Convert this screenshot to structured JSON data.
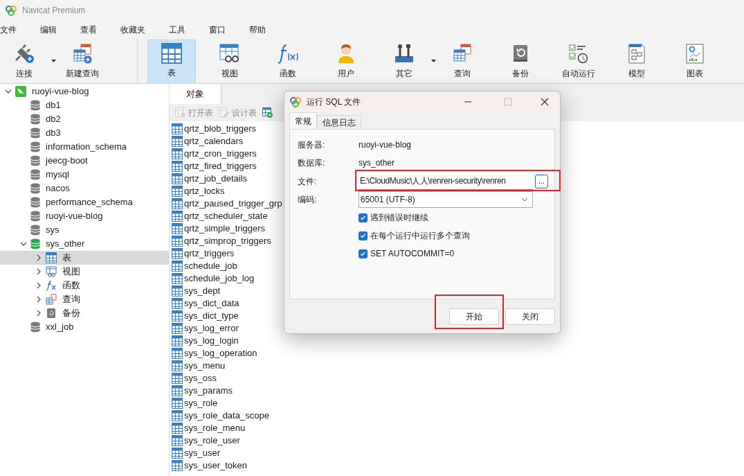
{
  "window": {
    "title": "Navicat Premium"
  },
  "menu": [
    "文件",
    "编辑",
    "查看",
    "收藏夹",
    "工具",
    "窗口",
    "帮助"
  ],
  "toolbar": [
    {
      "kind": "connect",
      "label": "连接",
      "selected": false,
      "dropdown": true
    },
    {
      "kind": "newquery",
      "label": "新建查询",
      "selected": false,
      "dropdown": false
    },
    {
      "kind": "table",
      "label": "表",
      "selected": true,
      "dropdown": false
    },
    {
      "kind": "view",
      "label": "视图",
      "selected": false,
      "dropdown": false
    },
    {
      "kind": "function",
      "label": "函数",
      "selected": false,
      "dropdown": false
    },
    {
      "kind": "user",
      "label": "用户",
      "selected": false,
      "dropdown": false
    },
    {
      "kind": "tools",
      "label": "其它",
      "selected": false,
      "dropdown": true
    },
    {
      "kind": "query",
      "label": "查询",
      "selected": false,
      "dropdown": false
    },
    {
      "kind": "backup",
      "label": "备份",
      "selected": false,
      "dropdown": false
    },
    {
      "kind": "schedule",
      "label": "自动运行",
      "selected": false,
      "dropdown": false
    },
    {
      "kind": "model",
      "label": "模型",
      "selected": false,
      "dropdown": false
    },
    {
      "kind": "chart",
      "label": "图表",
      "selected": false,
      "dropdown": false
    }
  ],
  "tree": [
    {
      "kind": "connection",
      "label": "ruoyi-vue-blog",
      "expanded": true,
      "selected": false,
      "children": [
        {
          "kind": "db",
          "label": "db1",
          "open": false,
          "selected": false
        },
        {
          "kind": "db",
          "label": "db2",
          "open": false,
          "selected": false
        },
        {
          "kind": "db",
          "label": "db3",
          "open": false,
          "selected": false
        },
        {
          "kind": "db",
          "label": "information_schema",
          "open": false,
          "selected": false
        },
        {
          "kind": "db",
          "label": "jeecg-boot",
          "open": false,
          "selected": false
        },
        {
          "kind": "db",
          "label": "mysql",
          "open": false,
          "selected": false
        },
        {
          "kind": "db",
          "label": "nacos",
          "open": false,
          "selected": false
        },
        {
          "kind": "db",
          "label": "performance_schema",
          "open": false,
          "selected": false
        },
        {
          "kind": "db",
          "label": "ruoyi-vue-blog",
          "open": false,
          "selected": false
        },
        {
          "kind": "db",
          "label": "sys",
          "open": false,
          "selected": false
        },
        {
          "kind": "db",
          "label": "sys_other",
          "open": true,
          "expanded": true,
          "selected": false,
          "children": [
            {
              "kind": "table",
              "label": "表",
              "expanded": false,
              "selected": true
            },
            {
              "kind": "view",
              "label": "视图",
              "expanded": false,
              "selected": false
            },
            {
              "kind": "function",
              "label": "函数",
              "expanded": false,
              "selected": false
            },
            {
              "kind": "query",
              "label": "查询",
              "expanded": false,
              "selected": false
            },
            {
              "kind": "backup",
              "label": "备份",
              "expanded": false,
              "selected": false
            }
          ]
        },
        {
          "kind": "db",
          "label": "xxl_job",
          "open": false,
          "selected": false
        }
      ]
    }
  ],
  "object_tab": {
    "label": "对象"
  },
  "object_toolbar": [
    {
      "kind": "open",
      "label": "打开表",
      "disabled": true
    },
    {
      "kind": "design",
      "label": "设计表",
      "disabled": true
    },
    {
      "kind": "new",
      "disabled": false
    }
  ],
  "tables": [
    "qrtz_blob_triggers",
    "qrtz_calendars",
    "qrtz_cron_triggers",
    "qrtz_fired_triggers",
    "qrtz_job_details",
    "qrtz_locks",
    "qrtz_paused_trigger_grp",
    "qrtz_scheduler_state",
    "qrtz_simple_triggers",
    "qrtz_simprop_triggers",
    "qrtz_triggers",
    "schedule_job",
    "schedule_job_log",
    "sys_dept",
    "sys_dict_data",
    "sys_dict_type",
    "sys_log_error",
    "sys_log_login",
    "sys_log_operation",
    "sys_menu",
    "sys_oss",
    "sys_params",
    "sys_role",
    "sys_role_data_scope",
    "sys_role_menu",
    "sys_role_user",
    "sys_user",
    "sys_user_token"
  ],
  "dialog": {
    "title": "运行 SQL 文件",
    "tabs": [
      {
        "label": "常规",
        "selected": true
      },
      {
        "label": "信息日志",
        "selected": false
      }
    ],
    "server_label": "服务器:",
    "server": "ruoyi-vue-blog",
    "database_label": "数据库:",
    "database": "sys_other",
    "file_label": "文件:",
    "file": "E:\\CloudMusic\\人人\\renren-security\\renren",
    "file_highlighted": true,
    "browse": "...",
    "encoding_label": "编码:",
    "encoding": "65001 (UTF-8)",
    "options": [
      {
        "label": "遇到错误时继续",
        "checked": true
      },
      {
        "label": "在每个运行中运行多个查询",
        "checked": true
      },
      {
        "label": "SET AUTOCOMMIT=0",
        "checked": true
      }
    ],
    "buttons": [
      {
        "label": "开始",
        "highlighted": true
      },
      {
        "label": "关闭",
        "highlighted": false
      }
    ]
  }
}
